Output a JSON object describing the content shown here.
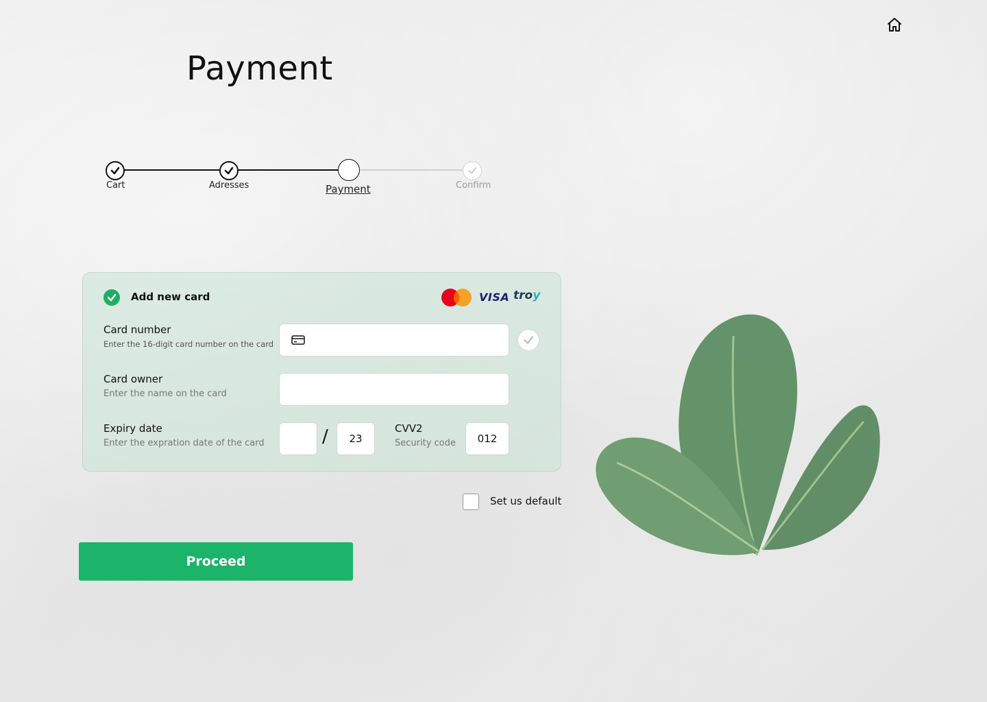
{
  "page": {
    "title": "Payment"
  },
  "nav": {
    "home_icon": "home-icon"
  },
  "stepper": {
    "steps": [
      {
        "label": "Cart",
        "state": "done"
      },
      {
        "label": "Adresses",
        "state": "done"
      },
      {
        "label": "Payment",
        "state": "current"
      },
      {
        "label": "Confirm",
        "state": "pending"
      }
    ]
  },
  "card_form": {
    "heading": "Add new card",
    "brands": [
      "mastercard",
      "VISA",
      "troy"
    ],
    "card_number": {
      "label": "Card number",
      "hint": "Enter the 16-digit card number on the card",
      "value": "",
      "icon": "credit-card-icon"
    },
    "card_owner": {
      "label": "Card owner",
      "hint": "Enter the name on the card",
      "value": ""
    },
    "expiry": {
      "label": "Expiry date",
      "hint": "Enter the expration date of the card",
      "month": "",
      "separator": "/",
      "year": "23"
    },
    "cvv": {
      "label": "CVV2",
      "hint": "Security code",
      "value": "012"
    }
  },
  "default_option": {
    "label": "Set us default",
    "checked": false
  },
  "actions": {
    "proceed_label": "Proceed"
  },
  "colors": {
    "accent_green": "#1cb46a",
    "panel_tint": "#c8e4d6",
    "visa_blue": "#1a1f71"
  }
}
